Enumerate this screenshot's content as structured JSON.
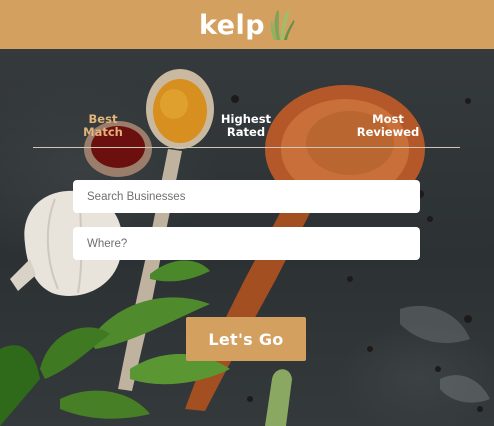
{
  "header": {
    "brand": "kelp",
    "logo_icon": "kelp-leaf-icon"
  },
  "tabs": [
    {
      "label": "Best\nMatch",
      "active": true
    },
    {
      "label": "Highest\nRated",
      "active": false
    },
    {
      "label": "Most\nReviewed",
      "active": false
    }
  ],
  "search": {
    "business_placeholder": "Search Businesses",
    "location_placeholder": "Where?",
    "business_value": "",
    "location_value": ""
  },
  "actions": {
    "submit_label": "Let's Go"
  },
  "colors": {
    "brand": "#d4a05f",
    "active_tab": "#e3b47a",
    "hero_dark": "#2f3436"
  }
}
